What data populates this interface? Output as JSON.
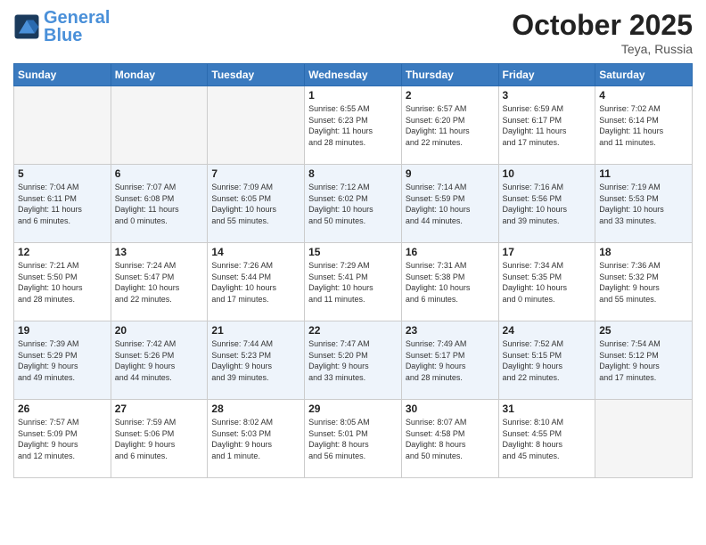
{
  "header": {
    "logo_general": "General",
    "logo_blue": "Blue",
    "month": "October 2025",
    "location": "Teya, Russia"
  },
  "days_of_week": [
    "Sunday",
    "Monday",
    "Tuesday",
    "Wednesday",
    "Thursday",
    "Friday",
    "Saturday"
  ],
  "weeks": [
    [
      {
        "day": "",
        "info": ""
      },
      {
        "day": "",
        "info": ""
      },
      {
        "day": "",
        "info": ""
      },
      {
        "day": "1",
        "info": "Sunrise: 6:55 AM\nSunset: 6:23 PM\nDaylight: 11 hours\nand 28 minutes."
      },
      {
        "day": "2",
        "info": "Sunrise: 6:57 AM\nSunset: 6:20 PM\nDaylight: 11 hours\nand 22 minutes."
      },
      {
        "day": "3",
        "info": "Sunrise: 6:59 AM\nSunset: 6:17 PM\nDaylight: 11 hours\nand 17 minutes."
      },
      {
        "day": "4",
        "info": "Sunrise: 7:02 AM\nSunset: 6:14 PM\nDaylight: 11 hours\nand 11 minutes."
      }
    ],
    [
      {
        "day": "5",
        "info": "Sunrise: 7:04 AM\nSunset: 6:11 PM\nDaylight: 11 hours\nand 6 minutes."
      },
      {
        "day": "6",
        "info": "Sunrise: 7:07 AM\nSunset: 6:08 PM\nDaylight: 11 hours\nand 0 minutes."
      },
      {
        "day": "7",
        "info": "Sunrise: 7:09 AM\nSunset: 6:05 PM\nDaylight: 10 hours\nand 55 minutes."
      },
      {
        "day": "8",
        "info": "Sunrise: 7:12 AM\nSunset: 6:02 PM\nDaylight: 10 hours\nand 50 minutes."
      },
      {
        "day": "9",
        "info": "Sunrise: 7:14 AM\nSunset: 5:59 PM\nDaylight: 10 hours\nand 44 minutes."
      },
      {
        "day": "10",
        "info": "Sunrise: 7:16 AM\nSunset: 5:56 PM\nDaylight: 10 hours\nand 39 minutes."
      },
      {
        "day": "11",
        "info": "Sunrise: 7:19 AM\nSunset: 5:53 PM\nDaylight: 10 hours\nand 33 minutes."
      }
    ],
    [
      {
        "day": "12",
        "info": "Sunrise: 7:21 AM\nSunset: 5:50 PM\nDaylight: 10 hours\nand 28 minutes."
      },
      {
        "day": "13",
        "info": "Sunrise: 7:24 AM\nSunset: 5:47 PM\nDaylight: 10 hours\nand 22 minutes."
      },
      {
        "day": "14",
        "info": "Sunrise: 7:26 AM\nSunset: 5:44 PM\nDaylight: 10 hours\nand 17 minutes."
      },
      {
        "day": "15",
        "info": "Sunrise: 7:29 AM\nSunset: 5:41 PM\nDaylight: 10 hours\nand 11 minutes."
      },
      {
        "day": "16",
        "info": "Sunrise: 7:31 AM\nSunset: 5:38 PM\nDaylight: 10 hours\nand 6 minutes."
      },
      {
        "day": "17",
        "info": "Sunrise: 7:34 AM\nSunset: 5:35 PM\nDaylight: 10 hours\nand 0 minutes."
      },
      {
        "day": "18",
        "info": "Sunrise: 7:36 AM\nSunset: 5:32 PM\nDaylight: 9 hours\nand 55 minutes."
      }
    ],
    [
      {
        "day": "19",
        "info": "Sunrise: 7:39 AM\nSunset: 5:29 PM\nDaylight: 9 hours\nand 49 minutes."
      },
      {
        "day": "20",
        "info": "Sunrise: 7:42 AM\nSunset: 5:26 PM\nDaylight: 9 hours\nand 44 minutes."
      },
      {
        "day": "21",
        "info": "Sunrise: 7:44 AM\nSunset: 5:23 PM\nDaylight: 9 hours\nand 39 minutes."
      },
      {
        "day": "22",
        "info": "Sunrise: 7:47 AM\nSunset: 5:20 PM\nDaylight: 9 hours\nand 33 minutes."
      },
      {
        "day": "23",
        "info": "Sunrise: 7:49 AM\nSunset: 5:17 PM\nDaylight: 9 hours\nand 28 minutes."
      },
      {
        "day": "24",
        "info": "Sunrise: 7:52 AM\nSunset: 5:15 PM\nDaylight: 9 hours\nand 22 minutes."
      },
      {
        "day": "25",
        "info": "Sunrise: 7:54 AM\nSunset: 5:12 PM\nDaylight: 9 hours\nand 17 minutes."
      }
    ],
    [
      {
        "day": "26",
        "info": "Sunrise: 7:57 AM\nSunset: 5:09 PM\nDaylight: 9 hours\nand 12 minutes."
      },
      {
        "day": "27",
        "info": "Sunrise: 7:59 AM\nSunset: 5:06 PM\nDaylight: 9 hours\nand 6 minutes."
      },
      {
        "day": "28",
        "info": "Sunrise: 8:02 AM\nSunset: 5:03 PM\nDaylight: 9 hours\nand 1 minute."
      },
      {
        "day": "29",
        "info": "Sunrise: 8:05 AM\nSunset: 5:01 PM\nDaylight: 8 hours\nand 56 minutes."
      },
      {
        "day": "30",
        "info": "Sunrise: 8:07 AM\nSunset: 4:58 PM\nDaylight: 8 hours\nand 50 minutes."
      },
      {
        "day": "31",
        "info": "Sunrise: 8:10 AM\nSunset: 4:55 PM\nDaylight: 8 hours\nand 45 minutes."
      },
      {
        "day": "",
        "info": ""
      }
    ]
  ]
}
